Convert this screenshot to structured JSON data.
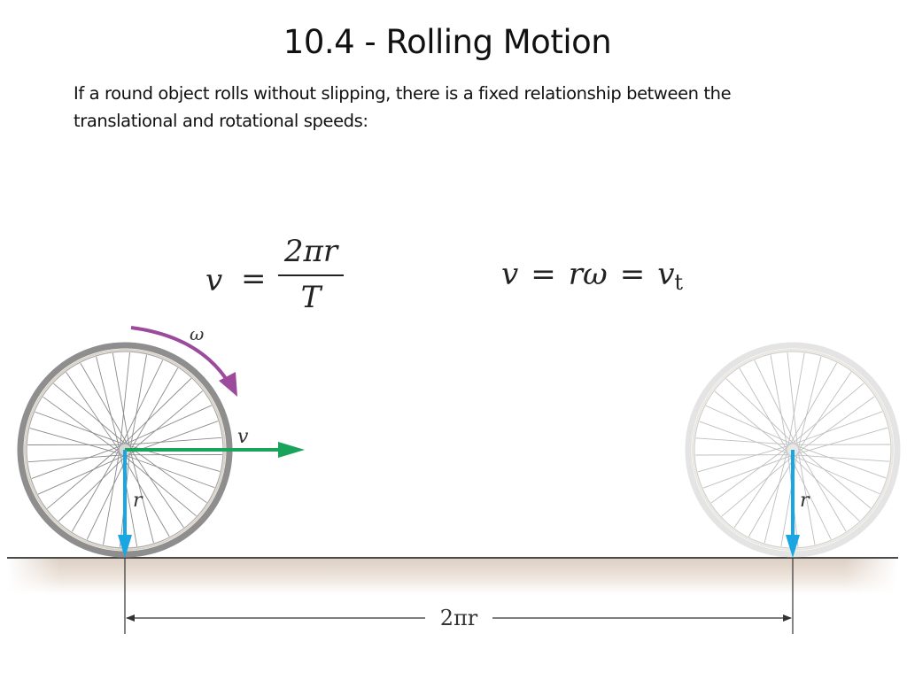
{
  "slide": {
    "title": "10.4 - Rolling Motion",
    "body": "If a round object rolls without slipping, there is a fixed relationship between the translational and rotational speeds:"
  },
  "formulas": {
    "period_formula": {
      "lhs": "v",
      "equals": "=",
      "numerator": "2πr",
      "denominator": "T"
    },
    "relation_formula": {
      "v": "v",
      "equals1": "=",
      "r_omega": "rω",
      "equals2": "=",
      "vt_main": "v",
      "vt_sub": "t"
    }
  },
  "diagram": {
    "labels": {
      "omega": "ω",
      "velocity": "v",
      "radius_left": "r",
      "radius_right": "r",
      "distance": "2πr"
    },
    "colors": {
      "omega_arrow": "#9b4a9c",
      "velocity_arrow": "#1aa35a",
      "radius_arrow": "#1aa6e2",
      "ground_line": "#4a4a4a",
      "ground_shadow": "#e2d6cc",
      "wheel_rim": "#8e8e8e",
      "wheel_rim_faded": "#cfcfcf"
    },
    "wheel_left": {
      "state": "start"
    },
    "wheel_right": {
      "state": "after one revolution",
      "faded": true
    }
  }
}
